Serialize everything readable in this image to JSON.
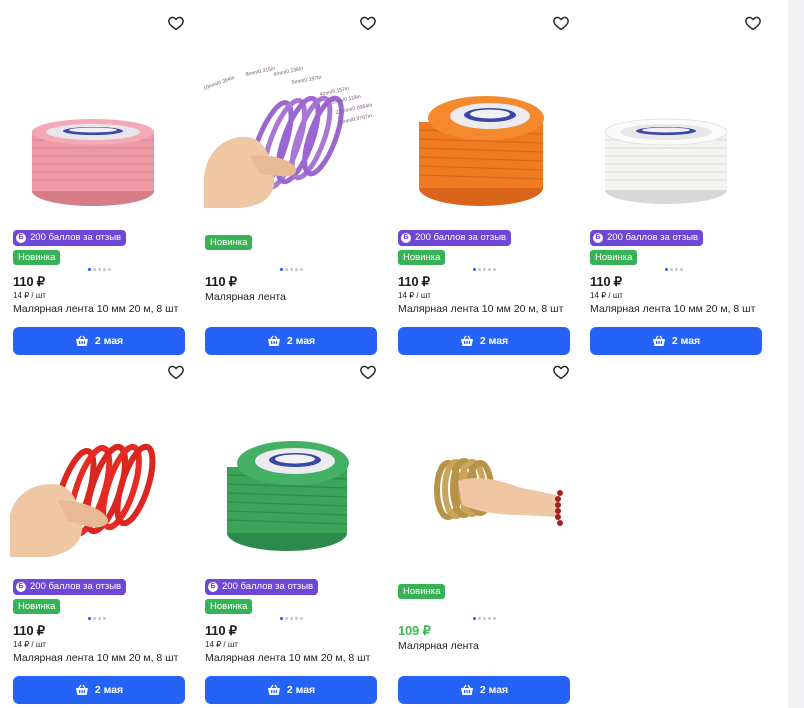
{
  "common": {
    "bonus_label": "200 баллов за отзыв",
    "bonus_coin": "Б",
    "novelty_label": "Новинка",
    "delivery_label": "2 мая",
    "unit_price": "14 ₽ / шт"
  },
  "colors": {
    "accent_blue": "#2463f6",
    "bonus_purple": "#6f47d6",
    "novelty_green": "#38b257",
    "discount_price_green": "#3fb85c"
  },
  "products": [
    {
      "price": "110 ₽",
      "unit": "14 ₽ / шт",
      "title": "Малярная лента 10 мм 20 м, 8 шт",
      "tape_color": "#ee9aa6",
      "bonus": true,
      "novelty": true
    },
    {
      "price": "110 ₽",
      "unit": "",
      "title": "Малярная лента",
      "tape_color": "#a877d6",
      "bonus": false,
      "novelty": true,
      "size_labels": [
        "10mm/0.394in",
        "8mm/0.315in",
        "6mm/0.236in",
        "5mm/0.197in",
        "4mm/0.157in",
        "3mm/0.118in",
        "2.5mm/0.0984in",
        "2mm/0.0787in"
      ]
    },
    {
      "price": "110 ₽",
      "unit": "14 ₽ / шт",
      "title": "Малярная лента 10 мм 20 м, 8 шт",
      "tape_color": "#f07a22",
      "bonus": true,
      "novelty": true
    },
    {
      "price": "110 ₽",
      "unit": "14 ₽ / шт",
      "title": "Малярная лента 10 мм 20 м, 8 шт",
      "tape_color": "#f4f4f2",
      "bonus": true,
      "novelty": true
    },
    {
      "price": "110 ₽",
      "unit": "14 ₽ / шт",
      "title": "Малярная лента 10 мм 20 м, 8 шт",
      "tape_color": "#e62a24",
      "bonus": true,
      "novelty": true
    },
    {
      "price": "110 ₽",
      "unit": "14 ₽ / шт",
      "title": "Малярная лента 10 мм 20 м, 8 шт",
      "tape_color": "#3aa45a",
      "bonus": true,
      "novelty": false
    },
    {
      "price": "109 ₽",
      "unit": "",
      "title": "Малярная лента",
      "tape_color": "#c9a55c",
      "bonus": false,
      "novelty": true,
      "discount": true
    }
  ]
}
